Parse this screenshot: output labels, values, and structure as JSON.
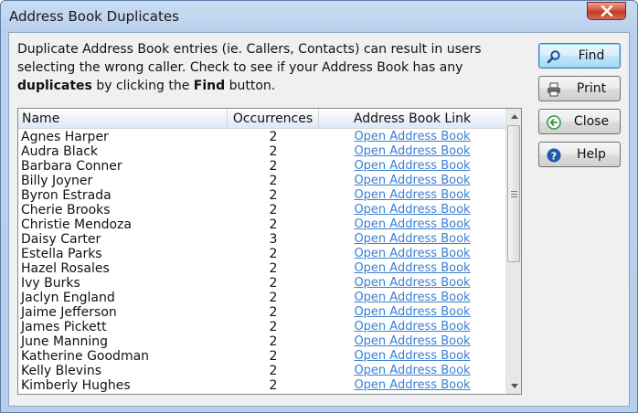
{
  "window": {
    "title": "Address Book Duplicates"
  },
  "description": {
    "part1": "Duplicate Address Book entries (ie. Callers, Contacts) can result in users selecting the wrong caller.  Check to see if your Address Book has any ",
    "bold1": "duplicates",
    "part2": " by clicking the ",
    "bold2": "Find",
    "part3": " button."
  },
  "table": {
    "columns": {
      "name": "Name",
      "occurrences": "Occurrences",
      "link": "Address Book Link"
    },
    "rows": [
      {
        "name": "Agnes Harper",
        "occurrences": "2",
        "link": "Open Address Book"
      },
      {
        "name": "Audra Black",
        "occurrences": "2",
        "link": "Open Address Book"
      },
      {
        "name": "Barbara Conner",
        "occurrences": "2",
        "link": "Open Address Book"
      },
      {
        "name": "Billy Joyner",
        "occurrences": "2",
        "link": "Open Address Book"
      },
      {
        "name": "Byron Estrada",
        "occurrences": "2",
        "link": "Open Address Book"
      },
      {
        "name": "Cherie Brooks",
        "occurrences": "2",
        "link": "Open Address Book"
      },
      {
        "name": "Christie Mendoza",
        "occurrences": "2",
        "link": "Open Address Book"
      },
      {
        "name": "Daisy Carter",
        "occurrences": "3",
        "link": "Open Address Book"
      },
      {
        "name": "Estella Parks",
        "occurrences": "2",
        "link": "Open Address Book"
      },
      {
        "name": "Hazel Rosales",
        "occurrences": "2",
        "link": "Open Address Book"
      },
      {
        "name": "Ivy Burks",
        "occurrences": "2",
        "link": "Open Address Book"
      },
      {
        "name": "Jaclyn England",
        "occurrences": "2",
        "link": "Open Address Book"
      },
      {
        "name": "Jaime Jefferson",
        "occurrences": "2",
        "link": "Open Address Book"
      },
      {
        "name": "James Pickett",
        "occurrences": "2",
        "link": "Open Address Book"
      },
      {
        "name": "June Manning",
        "occurrences": "2",
        "link": "Open Address Book"
      },
      {
        "name": "Katherine Goodman",
        "occurrences": "2",
        "link": "Open Address Book"
      },
      {
        "name": "Kelly Blevins",
        "occurrences": "2",
        "link": "Open Address Book"
      },
      {
        "name": "Kimberly Hughes",
        "occurrences": "2",
        "link": "Open Address Book"
      }
    ]
  },
  "buttons": {
    "find": {
      "label": "Find",
      "icon": "magnifier-icon"
    },
    "print": {
      "label": "Print",
      "icon": "printer-icon"
    },
    "close": {
      "label": "Close",
      "icon": "back-arrow-icon"
    },
    "help": {
      "label": "Help",
      "icon": "help-icon"
    }
  },
  "colors": {
    "link": "#3a7fd4",
    "close_button": "#c23c24",
    "title_bar": "#c9dcf3"
  }
}
